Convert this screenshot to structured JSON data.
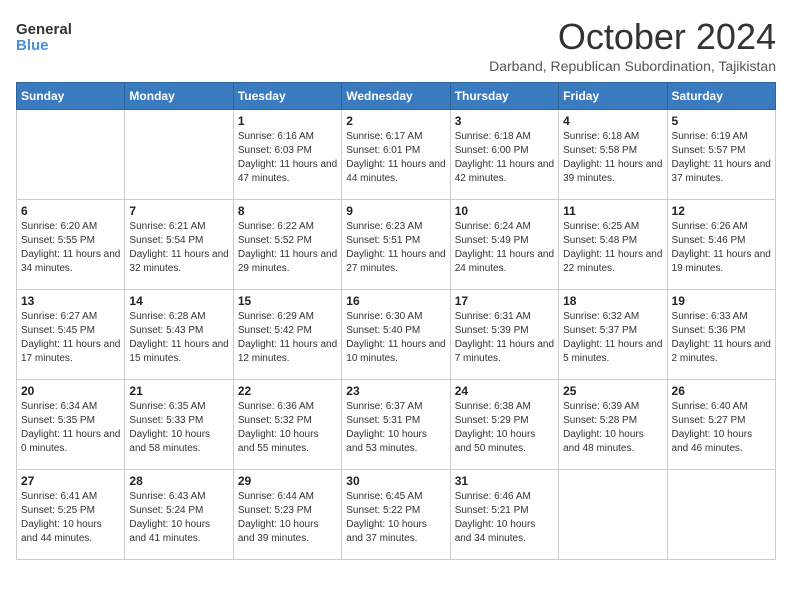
{
  "logo": {
    "general": "General",
    "blue": "Blue"
  },
  "title": "October 2024",
  "subtitle": "Darband, Republican Subordination, Tajikistan",
  "headers": [
    "Sunday",
    "Monday",
    "Tuesday",
    "Wednesday",
    "Thursday",
    "Friday",
    "Saturday"
  ],
  "weeks": [
    [
      {
        "day": "",
        "info": ""
      },
      {
        "day": "",
        "info": ""
      },
      {
        "day": "1",
        "info": "Sunrise: 6:16 AM\nSunset: 6:03 PM\nDaylight: 11 hours and 47 minutes."
      },
      {
        "day": "2",
        "info": "Sunrise: 6:17 AM\nSunset: 6:01 PM\nDaylight: 11 hours and 44 minutes."
      },
      {
        "day": "3",
        "info": "Sunrise: 6:18 AM\nSunset: 6:00 PM\nDaylight: 11 hours and 42 minutes."
      },
      {
        "day": "4",
        "info": "Sunrise: 6:18 AM\nSunset: 5:58 PM\nDaylight: 11 hours and 39 minutes."
      },
      {
        "day": "5",
        "info": "Sunrise: 6:19 AM\nSunset: 5:57 PM\nDaylight: 11 hours and 37 minutes."
      }
    ],
    [
      {
        "day": "6",
        "info": "Sunrise: 6:20 AM\nSunset: 5:55 PM\nDaylight: 11 hours and 34 minutes."
      },
      {
        "day": "7",
        "info": "Sunrise: 6:21 AM\nSunset: 5:54 PM\nDaylight: 11 hours and 32 minutes."
      },
      {
        "day": "8",
        "info": "Sunrise: 6:22 AM\nSunset: 5:52 PM\nDaylight: 11 hours and 29 minutes."
      },
      {
        "day": "9",
        "info": "Sunrise: 6:23 AM\nSunset: 5:51 PM\nDaylight: 11 hours and 27 minutes."
      },
      {
        "day": "10",
        "info": "Sunrise: 6:24 AM\nSunset: 5:49 PM\nDaylight: 11 hours and 24 minutes."
      },
      {
        "day": "11",
        "info": "Sunrise: 6:25 AM\nSunset: 5:48 PM\nDaylight: 11 hours and 22 minutes."
      },
      {
        "day": "12",
        "info": "Sunrise: 6:26 AM\nSunset: 5:46 PM\nDaylight: 11 hours and 19 minutes."
      }
    ],
    [
      {
        "day": "13",
        "info": "Sunrise: 6:27 AM\nSunset: 5:45 PM\nDaylight: 11 hours and 17 minutes."
      },
      {
        "day": "14",
        "info": "Sunrise: 6:28 AM\nSunset: 5:43 PM\nDaylight: 11 hours and 15 minutes."
      },
      {
        "day": "15",
        "info": "Sunrise: 6:29 AM\nSunset: 5:42 PM\nDaylight: 11 hours and 12 minutes."
      },
      {
        "day": "16",
        "info": "Sunrise: 6:30 AM\nSunset: 5:40 PM\nDaylight: 11 hours and 10 minutes."
      },
      {
        "day": "17",
        "info": "Sunrise: 6:31 AM\nSunset: 5:39 PM\nDaylight: 11 hours and 7 minutes."
      },
      {
        "day": "18",
        "info": "Sunrise: 6:32 AM\nSunset: 5:37 PM\nDaylight: 11 hours and 5 minutes."
      },
      {
        "day": "19",
        "info": "Sunrise: 6:33 AM\nSunset: 5:36 PM\nDaylight: 11 hours and 2 minutes."
      }
    ],
    [
      {
        "day": "20",
        "info": "Sunrise: 6:34 AM\nSunset: 5:35 PM\nDaylight: 11 hours and 0 minutes."
      },
      {
        "day": "21",
        "info": "Sunrise: 6:35 AM\nSunset: 5:33 PM\nDaylight: 10 hours and 58 minutes."
      },
      {
        "day": "22",
        "info": "Sunrise: 6:36 AM\nSunset: 5:32 PM\nDaylight: 10 hours and 55 minutes."
      },
      {
        "day": "23",
        "info": "Sunrise: 6:37 AM\nSunset: 5:31 PM\nDaylight: 10 hours and 53 minutes."
      },
      {
        "day": "24",
        "info": "Sunrise: 6:38 AM\nSunset: 5:29 PM\nDaylight: 10 hours and 50 minutes."
      },
      {
        "day": "25",
        "info": "Sunrise: 6:39 AM\nSunset: 5:28 PM\nDaylight: 10 hours and 48 minutes."
      },
      {
        "day": "26",
        "info": "Sunrise: 6:40 AM\nSunset: 5:27 PM\nDaylight: 10 hours and 46 minutes."
      }
    ],
    [
      {
        "day": "27",
        "info": "Sunrise: 6:41 AM\nSunset: 5:25 PM\nDaylight: 10 hours and 44 minutes."
      },
      {
        "day": "28",
        "info": "Sunrise: 6:43 AM\nSunset: 5:24 PM\nDaylight: 10 hours and 41 minutes."
      },
      {
        "day": "29",
        "info": "Sunrise: 6:44 AM\nSunset: 5:23 PM\nDaylight: 10 hours and 39 minutes."
      },
      {
        "day": "30",
        "info": "Sunrise: 6:45 AM\nSunset: 5:22 PM\nDaylight: 10 hours and 37 minutes."
      },
      {
        "day": "31",
        "info": "Sunrise: 6:46 AM\nSunset: 5:21 PM\nDaylight: 10 hours and 34 minutes."
      },
      {
        "day": "",
        "info": ""
      },
      {
        "day": "",
        "info": ""
      }
    ]
  ]
}
